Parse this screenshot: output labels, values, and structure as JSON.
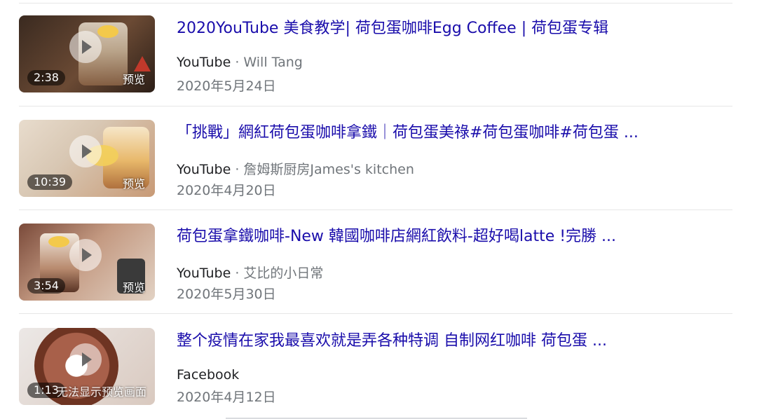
{
  "results": [
    {
      "title": "2020YouTube 美食教学| 荷包蛋咖啡Egg Coffee | 荷包蛋专辑",
      "source": "YouTube",
      "separator": "·",
      "author": "Will Tang",
      "date": "2020年5月24日",
      "duration": "2:38",
      "preview_label": "预览",
      "thumb_colors": [
        "#3a2a20",
        "#6b4a34",
        "#c9b59a"
      ]
    },
    {
      "title": "「挑戰」網紅荷包蛋咖啡拿鐵｜荷包蛋美祿#荷包蛋咖啡#荷包蛋 ...",
      "source": "YouTube",
      "separator": "·",
      "author": "詹姆斯厨房James's kitchen",
      "date": "2020年4月20日",
      "duration": "10:39",
      "preview_label": "预览",
      "thumb_colors": [
        "#d8c7b3",
        "#e8b86a",
        "#c89a76"
      ]
    },
    {
      "title": "荷包蛋拿鐵咖啡-New 韓國咖啡店網紅飲料-超好喝latte !完勝 ...",
      "source": "YouTube",
      "separator": "·",
      "author": "艾比的小日常",
      "date": "2020年5月30日",
      "duration": "3:54",
      "preview_label": "预览",
      "thumb_colors": [
        "#7a4a3a",
        "#e2d2c4",
        "#b88a6e"
      ]
    },
    {
      "title": "整个疫情在家我最喜欢就是弄各种特调 自制网红咖啡 荷包蛋 ...",
      "source": "Facebook",
      "separator": "",
      "author": "",
      "date": "2020年4月12日",
      "duration": "1:13",
      "preview_label": "无法显示预览画面",
      "thumb_colors": [
        "#e8e4e2",
        "#8a4a32",
        "#d9c9bf"
      ]
    }
  ]
}
